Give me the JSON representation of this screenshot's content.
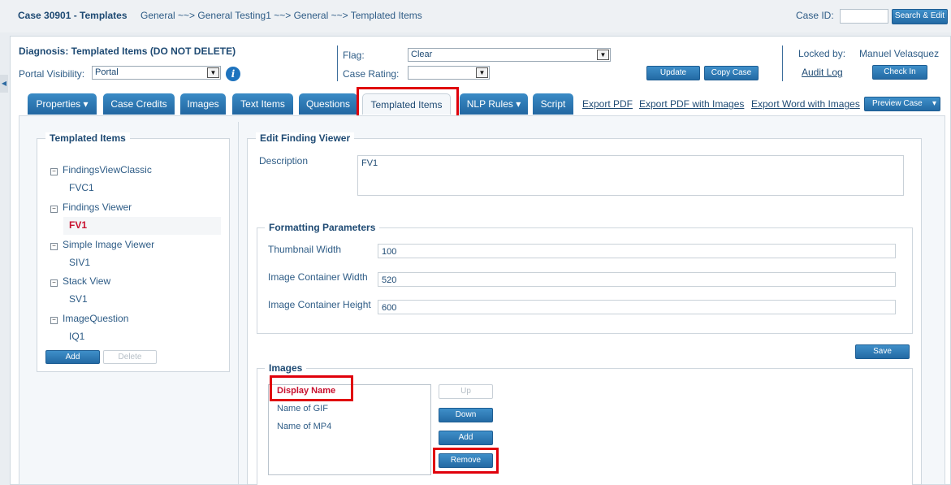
{
  "header": {
    "title": "Case 30901 - Templates",
    "breadcrumb": "General ~~> General Testing1 ~~> General ~~> Templated Items",
    "case_id_label": "Case ID:",
    "case_id_value": "",
    "search_button": "Search & Edit"
  },
  "case": {
    "diagnosis": "Diagnosis: Templated Items (DO NOT DELETE)",
    "portal_visibility_label": "Portal Visibility:",
    "portal_visibility_value": "Portal",
    "flag_label": "Flag:",
    "flag_value": "Clear",
    "case_rating_label": "Case Rating:",
    "case_rating_value": "",
    "update_button": "Update",
    "copy_case_button": "Copy Case",
    "locked_by_label": "Locked by:",
    "locked_by_value": "Manuel Velasquez",
    "audit_log_link": "Audit Log",
    "check_in_button": "Check In"
  },
  "tabs": [
    {
      "label": "Properties ▾"
    },
    {
      "label": "Case Credits"
    },
    {
      "label": "Images"
    },
    {
      "label": "Text Items"
    },
    {
      "label": "Questions"
    },
    {
      "label": "Templated Items"
    },
    {
      "label": "NLP Rules ▾"
    },
    {
      "label": "Script"
    }
  ],
  "export_links": {
    "pdf": "Export PDF",
    "pdf_images": "Export PDF with Images",
    "word_images": "Export Word with Images",
    "preview": "Preview Case"
  },
  "templated_items": {
    "legend": "Templated Items",
    "tree": [
      {
        "group": "FindingsViewClassic",
        "child": "FVC1"
      },
      {
        "group": "Findings Viewer",
        "child": "FV1"
      },
      {
        "group": "Simple Image Viewer",
        "child": "SIV1"
      },
      {
        "group": "Stack View",
        "child": "SV1"
      },
      {
        "group": "ImageQuestion",
        "child": "IQ1"
      }
    ],
    "add_button": "Add",
    "delete_button": "Delete"
  },
  "editor": {
    "legend": "Edit Finding Viewer",
    "description_label": "Description",
    "description_value": "FV1",
    "formatting_legend": "Formatting Parameters",
    "thumbnail_width_label": "Thumbnail Width",
    "thumbnail_width_value": "100",
    "container_width_label": "Image Container Width",
    "container_width_value": "520",
    "container_height_label": "Image Container Height",
    "container_height_value": "600",
    "save_button": "Save",
    "images_legend": "Images",
    "images": [
      "Display Name",
      "Name of GIF",
      "Name of MP4"
    ],
    "up_button": "Up",
    "down_button": "Down",
    "add_button": "Add",
    "remove_button": "Remove"
  },
  "colors": {
    "accent": "#236aa4",
    "highlight": "#e0000b",
    "selected_text": "#c8102e"
  }
}
